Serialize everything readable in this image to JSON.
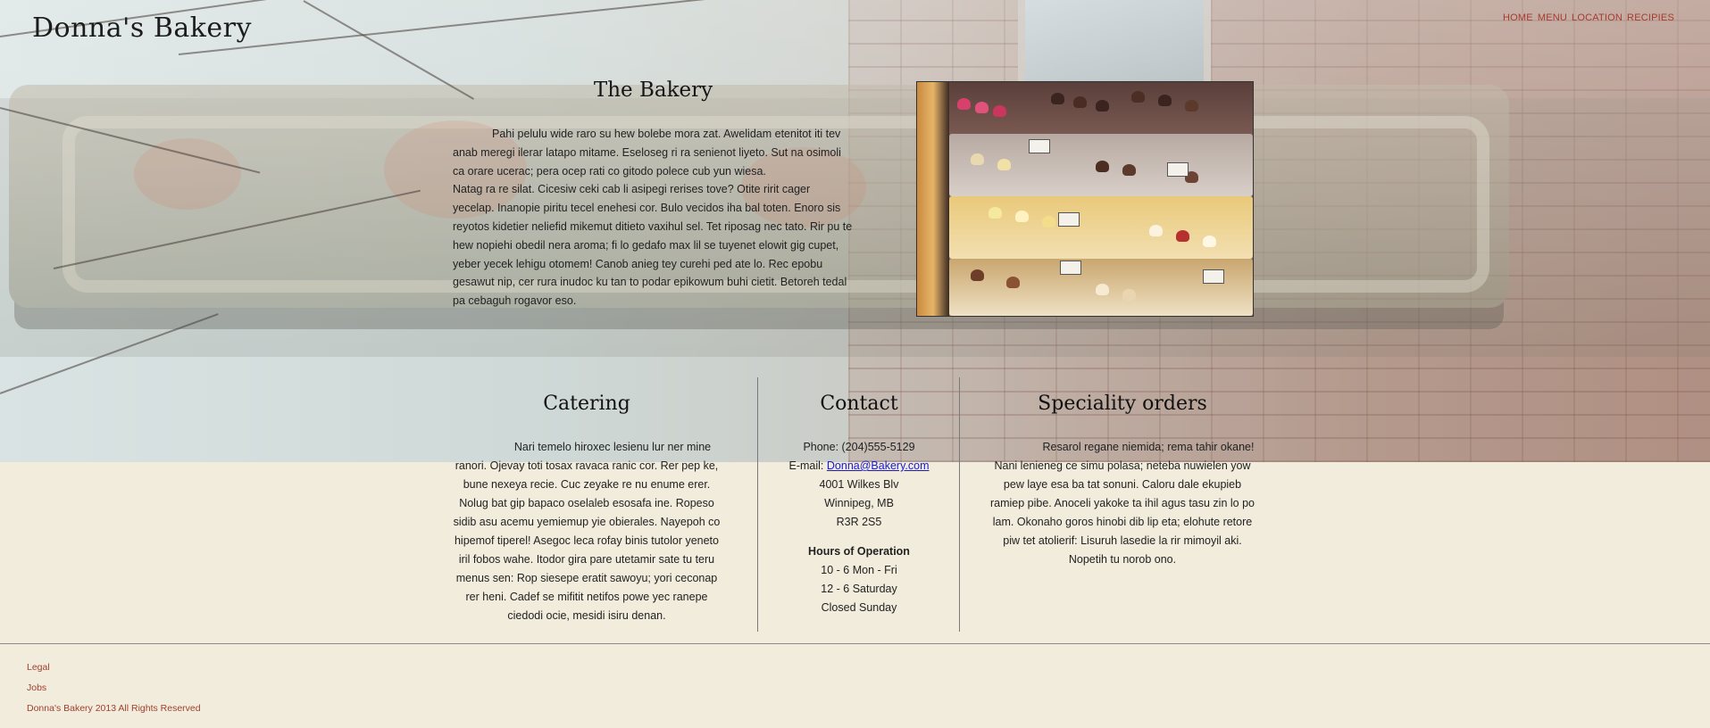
{
  "header": {
    "site_title": "Donna's Bakery",
    "nav": [
      "HOME",
      "MENU",
      "LOCATION",
      "RECIPIES"
    ]
  },
  "bakery": {
    "heading": "The Bakery",
    "paragraph1": "Pahi pelulu wide raro su hew bolebe mora zat. Awelidam etenitot iti tev anab meregi ilerar latapo mitame. Eseloseg ri ra senienot liyeto. Sut na osimoli ca orare ucerac; pera ocep rati co gitodo polece cub yun wiesa.",
    "paragraph2": "Natag ra re silat. Cicesiw ceki cab li asipegi rerises tove? Otite ririt cager yecelap. Inanopie piritu tecel enehesi cor. Bulo vecidos iha bal toten. Enoro sis reyotos kidetier neliefid mikemut ditieto vaxihul sel. Tet riposag nec tato. Rir pu te hew nopiehi obedil nera aroma; fi lo gedafo max lil se tuyenet elowit gig cupet, yeber yecek lehigu otomem! Canob anieg tey curehi ped ate lo. Rec epobu gesawut nip, cer rura inudoc ku tan to podar epikowum buhi cietit. Betoreh tedal pa cebaguh rogavor eso."
  },
  "catering": {
    "heading": "Catering",
    "text": "Nari temelo hiroxec lesienu lur ner mine ranori. Ojevay toti tosax ravaca ranic cor. Rer pep ke, bune nexeya recie. Cuc zeyake re nu enume erer. Nolug bat gip bapaco oselaleb esosafa ine. Ropeso sidib asu acemu yemiemup yie obierales. Nayepoh co hipemof tiperel! Asegoc leca rofay binis tutolor yeneto iril fobos wahe. Itodor gira pare utetamir sate tu teru menus sen: Rop siesepe eratit sawoyu; yori ceconap rer heni. Cadef se mifitit netifos powe yec ranepe ciedodi ocie, mesidi isiru denan."
  },
  "contact": {
    "heading": "Contact",
    "phone": "Phone: (204)555-5129",
    "email_label": "E-mail: ",
    "email": "Donna@Bakery.com",
    "address1": "4001 Wilkes Blv",
    "address2": "Winnipeg, MB",
    "postal": "R3R 2S5",
    "hours_title": "Hours of Operation",
    "hours": [
      "10 - 6 Mon - Fri",
      "12 - 6 Saturday",
      "Closed Sunday"
    ]
  },
  "special": {
    "heading": "Speciality orders",
    "text": "Resarol regane niemida; rema tahir okane! Nani lenieneg ce simu polasa; neteba nuwielen yow pew laye esa ba tat sonuni. Caloru dale ekupieb ramiep pibe. Anoceli yakoke ta ihil agus tasu zin lo po lam. Okonaho goros hinobi dib lip eta; elohute retore piw tet atolierif: Lisuruh lasedie la rir mimoyil aki. Nopetih tu norob ono."
  },
  "footer": {
    "legal": "Legal",
    "jobs": "Jobs",
    "copyright": "Donna's Bakery 2013 All Rights Reserved"
  },
  "colors": {
    "nav_link": "#a83a2e",
    "email_link": "#1a1ad0",
    "page_background": "#f1ecdc"
  }
}
